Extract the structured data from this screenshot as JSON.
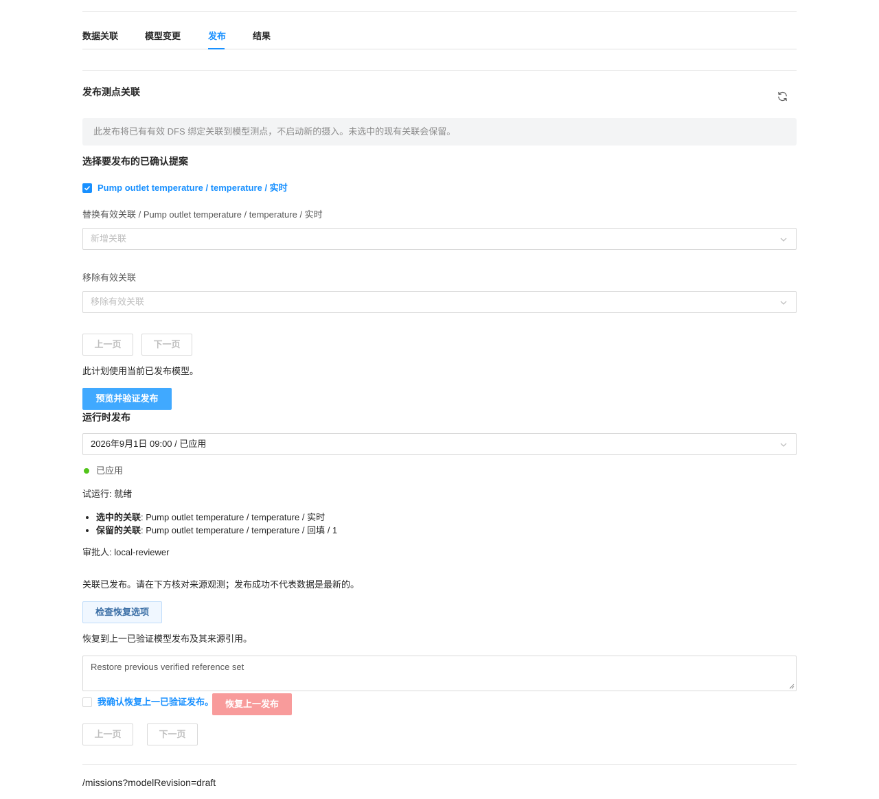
{
  "tabs": [
    {
      "label": "数据关联"
    },
    {
      "label": "模型变更"
    },
    {
      "label": "发布"
    },
    {
      "label": "结果"
    }
  ],
  "active_tab": "发布",
  "section": {
    "title": "发布测点关联",
    "notice": "此发布将已有有效 DFS 绑定关联到模型测点，不启动新的摄入。未选中的现有关联会保留。"
  },
  "proposals": {
    "heading": "选择要发布的已确认提案",
    "item_label": "Pump outlet temperature / temperature / 实时",
    "item_checked": true
  },
  "replace": {
    "label": "替换有效关联 / Pump outlet temperature / temperature / 实时",
    "placeholder": "新增关联"
  },
  "remove": {
    "label": "移除有效关联",
    "placeholder": "移除有效关联"
  },
  "pager1": {
    "prev": "上一页",
    "next": "下一页"
  },
  "plan_note": "此计划使用当前已发布模型。",
  "preview_button": "预览并验证发布",
  "runtime": {
    "title": "运行时发布",
    "selected": "2026年9月1日 09:00 / 已应用",
    "status": "已应用",
    "status_color": "#52c41a",
    "trial": "试运行: 就绪",
    "details": [
      {
        "key": "选中的关联",
        "value": ": Pump outlet temperature / temperature / 实时"
      },
      {
        "key": "保留的关联",
        "value": ": Pump outlet temperature / temperature / 回填 / 1"
      }
    ],
    "approver": "审批人: local-reviewer",
    "published_note": "关联已发布。请在下方核对来源观测；发布成功不代表数据是最新的。"
  },
  "recovery": {
    "check_button": "检查恢复选项",
    "note": "恢复到上一已验证模型发布及其来源引用。",
    "reason_value": "Restore previous verified reference set",
    "confirm_label": "我确认恢复上一已验证发布。",
    "confirm_checked": false,
    "restore_button": "恢复上一发布"
  },
  "pager2": {
    "prev": "上一页",
    "next": "下一页"
  },
  "footer_path": "/missions?modelRevision=draft",
  "colors": {
    "accent": "#1890ff",
    "primary_button": "#40a9ff",
    "danger_button": "#f89b9b"
  },
  "icons": {
    "refresh": "refresh-icon",
    "chevron": "chevron-down-icon",
    "check": "check-icon"
  }
}
